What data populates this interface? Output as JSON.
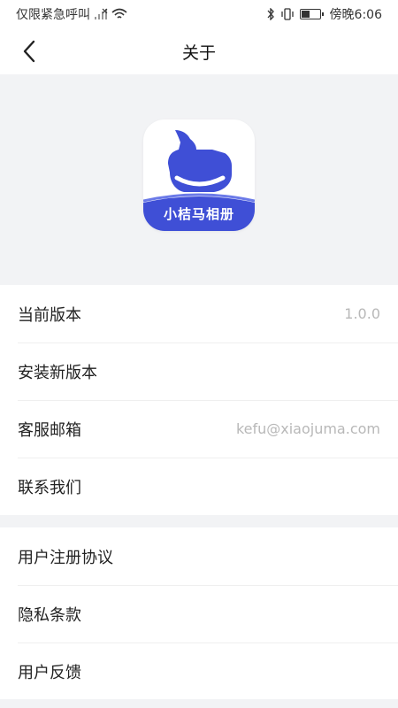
{
  "status_bar": {
    "carrier_text": "仅限紧急呼叫",
    "time": "傍晚6:06",
    "icons": [
      "signal-icon",
      "wifi-icon",
      "bluetooth-icon",
      "vibrate-icon",
      "battery-icon"
    ]
  },
  "nav": {
    "back_icon": "chevron-left-icon",
    "title": "关于"
  },
  "app": {
    "logo_text": "小桔马相册",
    "brand_color": "#3f4fd6"
  },
  "group1": {
    "items": [
      {
        "label": "当前版本",
        "value": "1.0.0"
      },
      {
        "label": "安装新版本"
      },
      {
        "label": "客服邮箱",
        "value": "kefu@xiaojuma.com"
      },
      {
        "label": "联系我们"
      }
    ]
  },
  "group2": {
    "items": [
      {
        "label": "用户注册协议"
      },
      {
        "label": "隐私条款"
      },
      {
        "label": "用户反馈"
      }
    ]
  }
}
